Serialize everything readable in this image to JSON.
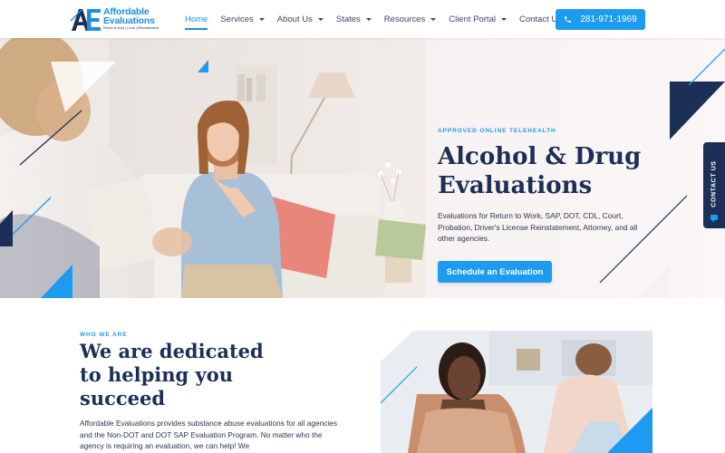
{
  "brand": {
    "logo_letters": "AE",
    "name_line1": "Affordable",
    "name_line2": "Evaluations",
    "tagline": "Return to Duty | Court | Reinstatement"
  },
  "nav": {
    "items": [
      {
        "label": "Home",
        "active": true,
        "dropdown": false
      },
      {
        "label": "Services",
        "active": false,
        "dropdown": true
      },
      {
        "label": "About Us",
        "active": false,
        "dropdown": true
      },
      {
        "label": "States",
        "active": false,
        "dropdown": true
      },
      {
        "label": "Resources",
        "active": false,
        "dropdown": true
      },
      {
        "label": "Client Portal",
        "active": false,
        "dropdown": true
      },
      {
        "label": "Contact Us",
        "active": false,
        "dropdown": false
      }
    ],
    "phone": "281-971-1969",
    "phone_icon": "phone-icon"
  },
  "hero": {
    "eyebrow": "APPROVED ONLINE TELEHEALTH",
    "title_line1": "Alcohol & Drug",
    "title_line2": "Evaluations",
    "description": "Evaluations for Return to Work, SAP, DOT, CDL, Court, Probation, Driver's License Reinstatement, Attorney, and all other agencies.",
    "cta_label": "Schedule an Evaluation",
    "contact_tab_label": "CONTACT US"
  },
  "who": {
    "eyebrow": "WHO WE ARE",
    "title_line1": "We are dedicated",
    "title_line2": "to helping you",
    "title_line3": "succeed",
    "description": "Affordable Evaluations provides substance abuse evaluations for all agencies and the Non-DOT and DOT SAP Evaluation Program.  No matter who the agency is requiring an evaluation, we can help! We"
  },
  "colors": {
    "accent": "#1d9bf0",
    "navy": "#1b2f57",
    "text": "#2c3650"
  }
}
